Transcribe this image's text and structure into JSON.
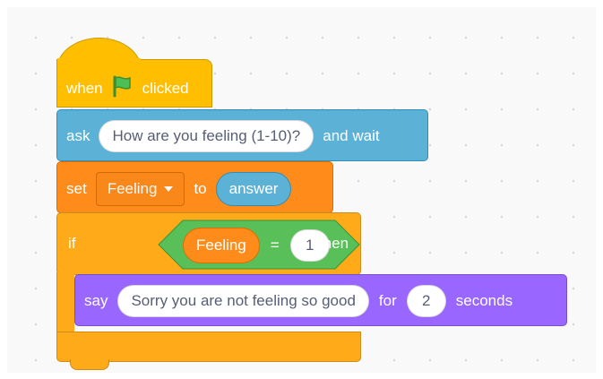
{
  "workspace": {
    "hat_block": {
      "when_label": "when",
      "flag_icon": "green-flag-icon",
      "clicked_label": "clicked"
    },
    "ask_block": {
      "ask_label": "ask",
      "question": "How are you feeling (1-10)?",
      "and_wait_label": "and wait"
    },
    "set_block": {
      "set_label": "set",
      "variable": "Feeling",
      "to_label": "to",
      "value_reporter": "answer"
    },
    "if_block": {
      "if_label": "if",
      "then_label": "then",
      "condition": {
        "left_reporter": "Feeling",
        "operator": "=",
        "right_value": "1"
      }
    },
    "say_block": {
      "say_label": "say",
      "message": "Sorry you are not feeling so good",
      "for_label": "for",
      "duration": "2",
      "seconds_label": "seconds"
    }
  },
  "colors": {
    "events": "#ffbf00",
    "sensing": "#5cb1d6",
    "variables": "#ff8c1a",
    "control": "#ffab19",
    "operators": "#59c059",
    "looks": "#9966ff"
  }
}
